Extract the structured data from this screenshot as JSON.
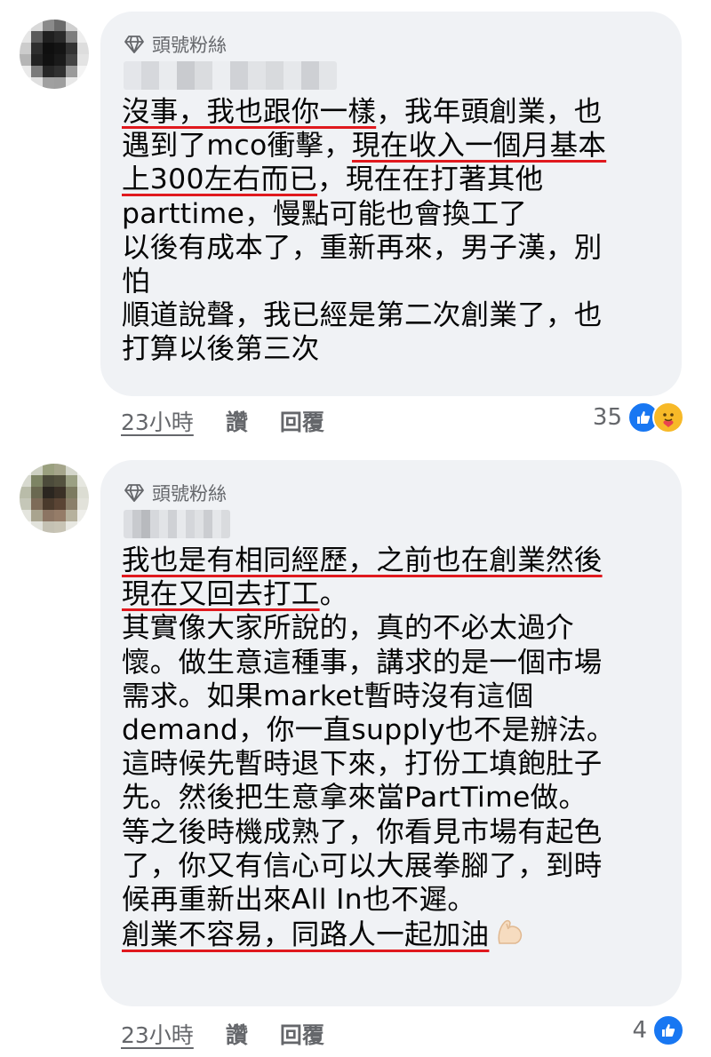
{
  "comments": [
    {
      "badge": "頭號粉絲",
      "lines": [
        [
          {
            "t": "沒事，我也跟你一樣",
            "hl": true
          },
          {
            "t": "，我年頭創業，也"
          }
        ],
        [
          {
            "t": "遇到了mco衝擊，"
          },
          {
            "t": "現在收入一個月基本",
            "hl": true
          }
        ],
        [
          {
            "t": "上300左右而已",
            "hl": true
          },
          {
            "t": "，現在在打著其他"
          }
        ],
        [
          {
            "t": "parttime，慢點可能也會換工了"
          }
        ],
        [
          {
            "t": "以後有成本了，重新再來，男子漢，別"
          }
        ],
        [
          {
            "t": "怕"
          }
        ],
        [
          {
            "t": "順道說聲，我已經是第二次創業了，也"
          }
        ],
        [
          {
            "t": "打算以後第三次"
          }
        ]
      ],
      "time": "23小時",
      "like": "讚",
      "reply": "回覆",
      "reaction_count": "35",
      "reactions": [
        "like-icon",
        "care-icon"
      ]
    },
    {
      "badge": "頭號粉絲",
      "lines": [
        [
          {
            "t": "我也是有相同經歷，之前也在創業然後",
            "hl": true
          }
        ],
        [
          {
            "t": "現在又回去打工",
            "hl": true
          },
          {
            "t": "。"
          }
        ],
        [
          {
            "t": "其實像大家所說的，真的不必太過介"
          }
        ],
        [
          {
            "t": "懷。做生意這種事，講求的是一個市場"
          }
        ],
        [
          {
            "t": "需求。如果market暫時沒有這個"
          }
        ],
        [
          {
            "t": "demand，你一直supply也不是辦法。"
          }
        ],
        [
          {
            "t": "這時候先暫時退下來，打份工填飽肚子"
          }
        ],
        [
          {
            "t": "先。然後把生意拿來當PartTime做。"
          }
        ],
        [
          {
            "t": "等之後時機成熟了，你看見市場有起色"
          }
        ],
        [
          {
            "t": "了，你又有信心可以大展拳腳了，到時"
          }
        ],
        [
          {
            "t": "候再重新出來All In也不遲。"
          }
        ],
        [
          {
            "t": "創業不容易，同路人一起加油",
            "hl": true
          }
        ]
      ],
      "time": "23小時",
      "like": "讚",
      "reply": "回覆",
      "reaction_count": "4",
      "reactions": [
        "like-icon"
      ]
    }
  ],
  "colors": {
    "bubble": "#f0f2f5",
    "meta": "#65676b",
    "underline": "#e0191e",
    "like": "#1877f2"
  }
}
